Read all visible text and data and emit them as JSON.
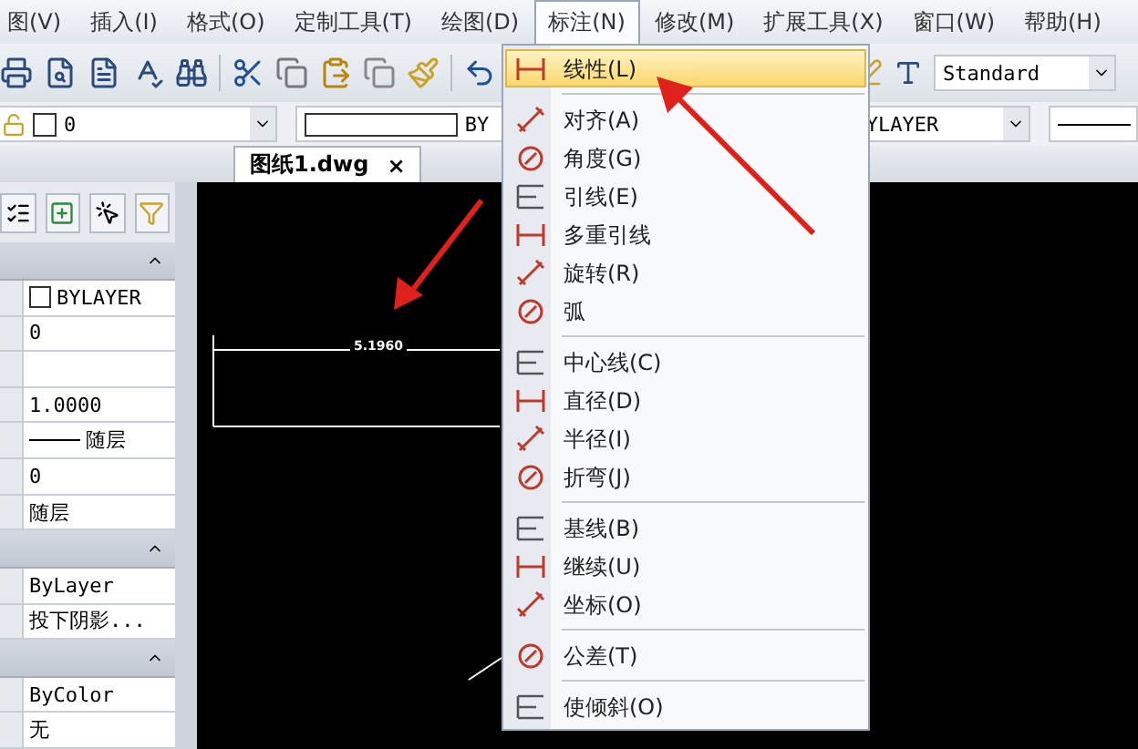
{
  "menubar": [
    {
      "label": "图(V)",
      "selected": false
    },
    {
      "label": "插入(I)",
      "selected": false
    },
    {
      "label": "格式(O)",
      "selected": false
    },
    {
      "label": "定制工具(T)",
      "selected": false
    },
    {
      "label": "绘图(D)",
      "selected": false
    },
    {
      "label": "标注(N)",
      "selected": true
    },
    {
      "label": "修改(M)",
      "selected": false
    },
    {
      "label": "扩展工具(X)",
      "selected": false
    },
    {
      "label": "窗口(W)",
      "selected": false
    },
    {
      "label": "帮助(H)",
      "selected": false
    }
  ],
  "toolbar": {
    "text_style": "Standard"
  },
  "layer_bar": {
    "layer": "0",
    "color_value": "BY",
    "linetype": "YLAYER"
  },
  "tabs": [
    {
      "label": "图纸1.dwg",
      "close": "×",
      "selected": true
    }
  ],
  "properties": {
    "sections": [
      {
        "rows": [
          {
            "kind": "color",
            "value": "BYLAYER"
          },
          {
            "kind": "text",
            "value": "0"
          },
          {
            "kind": "empty"
          },
          {
            "kind": "text",
            "value": "1.0000"
          },
          {
            "kind": "linetype",
            "value": "随层"
          },
          {
            "kind": "text",
            "value": "0"
          },
          {
            "kind": "text",
            "value": "随层"
          }
        ]
      },
      {
        "rows": [
          {
            "kind": "text",
            "value": "ByLayer"
          },
          {
            "kind": "text",
            "value": "投下阴影..."
          }
        ]
      },
      {
        "rows": [
          {
            "kind": "text",
            "value": "ByColor"
          },
          {
            "kind": "text",
            "value": "无"
          }
        ]
      }
    ]
  },
  "canvas": {
    "dimension_text": "5.1960"
  },
  "dimension_menu": {
    "items": [
      {
        "kind": "command",
        "label": "线性(L)",
        "selected": true
      },
      {
        "kind": "separator"
      },
      {
        "kind": "command",
        "label": "对齐(A)",
        "selected": false
      },
      {
        "kind": "command",
        "label": "角度(G)",
        "selected": false
      },
      {
        "kind": "command",
        "label": "引线(E)",
        "selected": false
      },
      {
        "kind": "command",
        "label": "多重引线",
        "selected": false
      },
      {
        "kind": "command",
        "label": "旋转(R)",
        "selected": false
      },
      {
        "kind": "command",
        "label": "弧",
        "selected": false
      },
      {
        "kind": "separator"
      },
      {
        "kind": "command",
        "label": "中心线(C)",
        "selected": false
      },
      {
        "kind": "command",
        "label": "直径(D)",
        "selected": false
      },
      {
        "kind": "command",
        "label": "半径(I)",
        "selected": false
      },
      {
        "kind": "command",
        "label": "折弯(J)",
        "selected": false
      },
      {
        "kind": "separator"
      },
      {
        "kind": "command",
        "label": "基线(B)",
        "selected": false
      },
      {
        "kind": "command",
        "label": "继续(U)",
        "selected": false
      },
      {
        "kind": "command",
        "label": "坐标(O)",
        "selected": false
      },
      {
        "kind": "separator"
      },
      {
        "kind": "command",
        "label": "公差(T)",
        "selected": false
      },
      {
        "kind": "separator"
      },
      {
        "kind": "command",
        "label": "使倾斜(O)",
        "selected": false
      }
    ]
  }
}
